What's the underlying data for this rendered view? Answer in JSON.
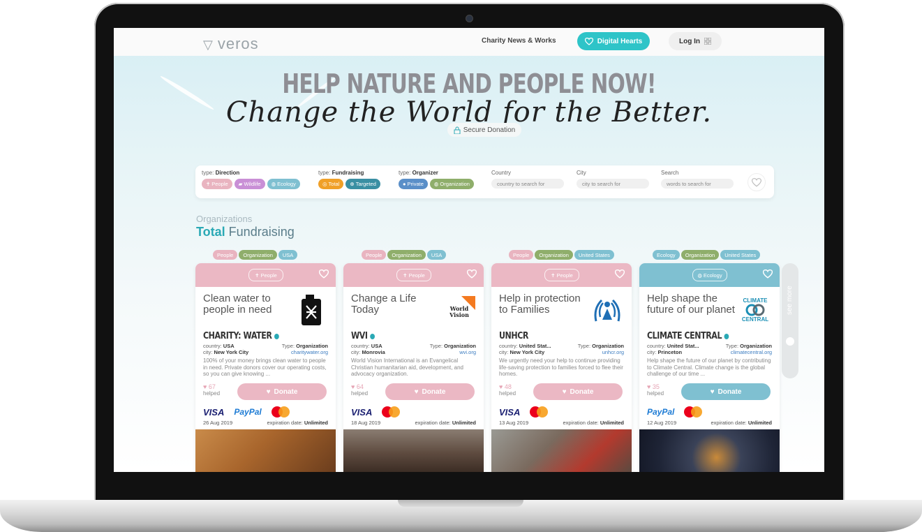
{
  "nav": {
    "logo": "veros",
    "charity_news": "Charity News & Works",
    "digital_hearts": "Digital Hearts",
    "login": "Log In"
  },
  "hero": {
    "title": "HELP NATURE AND PEOPLE NOW!",
    "script": "Change the World for the Better.",
    "secure": "Secure Donation"
  },
  "filters": {
    "direction": {
      "label": "type: ",
      "value": "Direction",
      "chips": [
        "People",
        "Wildlife",
        "Ecology"
      ]
    },
    "fundraising": {
      "label": "type: ",
      "value": "Fundraising",
      "chips": [
        "Total",
        "Targeted"
      ]
    },
    "organizer": {
      "label": "type: ",
      "value": "Organizer",
      "chips": [
        "Private",
        "Organization"
      ]
    },
    "country": {
      "label": "Country",
      "placeholder": "country to search for"
    },
    "city": {
      "label": "City",
      "placeholder": "city to search for"
    },
    "search": {
      "label": "Search",
      "placeholder": "words to search for"
    }
  },
  "section": {
    "subtitle": "Organizations",
    "title_bold": "Total",
    "title_rest": " Fundraising"
  },
  "colors": {
    "teal": "#2ec4c8",
    "pink": "#e9b4c0",
    "blue": "#7fc0d1",
    "green": "#8fae6b",
    "orange": "#f0a028"
  },
  "cards": [
    {
      "tags": [
        "People",
        "Organization",
        "USA"
      ],
      "category": "People",
      "title": "Clean water to people in need",
      "org": "CHARITY: WATER",
      "country_label": "country:",
      "country": "USA",
      "city_label": "city:",
      "city": "New York City",
      "type_label": "Type:",
      "type": "Organization",
      "website": "charitywater.org",
      "desc": "100% of your money brings clean water to people in need. Private donors cover our operating costs, so you can give knowing ...",
      "helped": "67",
      "helped_label": "helped",
      "donate": "Donate",
      "date": "26 Aug 2019",
      "exp_label": "expiration date:",
      "exp": "Unlimited",
      "payments": [
        "VISA",
        "PayPal",
        "MasterCard"
      ]
    },
    {
      "tags": [
        "People",
        "Organization",
        "USA"
      ],
      "category": "People",
      "title": "Change a Life Today",
      "org": "WVI",
      "country_label": "country:",
      "country": "USA",
      "city_label": "city:",
      "city": "Monrovia",
      "type_label": "Type:",
      "type": "Organization",
      "website": "wvi.org",
      "desc": "World Vision International is an Evangelical Christian humanitarian aid, development, and advocacy organization.",
      "helped": "64",
      "helped_label": "helped",
      "donate": "Donate",
      "date": "18 Aug 2019",
      "exp_label": "expiration date:",
      "exp": "Unlimited",
      "payments": [
        "VISA",
        "MasterCard"
      ],
      "logo_text": "World Vision"
    },
    {
      "tags": [
        "People",
        "Organization",
        "United States"
      ],
      "category": "People",
      "title": "Help in protection to Families",
      "org": "UNHCR",
      "country_label": "country:",
      "country": "United Stat...",
      "city_label": "city:",
      "city": "New York City",
      "type_label": "Type:",
      "type": "Organization",
      "website": "unhcr.org",
      "desc": "We urgently need your help to continue providing life-saving protection to families forced to flee their homes.",
      "helped": "48",
      "helped_label": "helped",
      "donate": "Donate",
      "date": "13 Aug 2019",
      "exp_label": "expiration date:",
      "exp": "Unlimited",
      "payments": [
        "VISA",
        "MasterCard"
      ]
    },
    {
      "tags": [
        "Ecology",
        "Organization",
        "United States"
      ],
      "category": "Ecology",
      "title": "Help shape the future of our planet",
      "org": "CLIMATE CENTRAL",
      "country_label": "country:",
      "country": "United Stat...",
      "city_label": "city:",
      "city": "Princeton",
      "type_label": "Type:",
      "type": "Organization",
      "website": "climatecentral.org",
      "desc": "Help shape the future of our planet by contributing to Climate Central. Climate change is the global challenge of our time ...",
      "helped": "35",
      "helped_label": "helped",
      "donate": "Donate",
      "date": "12 Aug 2019",
      "exp_label": "expiration date:",
      "exp": "Unlimited",
      "payments": [
        "PayPal",
        "MasterCard"
      ],
      "logo_text_1": "CLIMATE",
      "logo_text_2": "CENTRAL"
    }
  ],
  "see_more": "see more"
}
